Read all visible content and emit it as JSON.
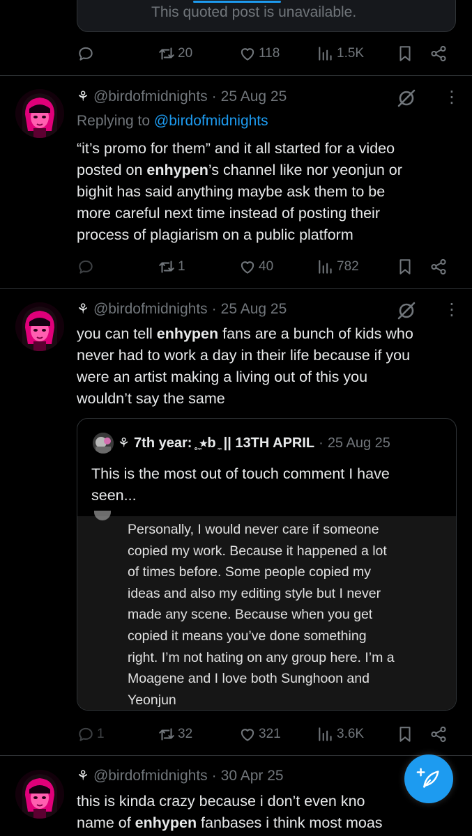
{
  "top_quote": {
    "text": "This quoted post is unavailable."
  },
  "top_actions": {
    "reposts": "20",
    "likes": "118",
    "views": "1.5K"
  },
  "tweets": [
    {
      "handle": "@birdofmidnights",
      "date": "25 Aug 25",
      "replying_label": "Replying to",
      "replying_handle": "@birdofmidnights",
      "lines": [
        [
          "“it’s promo for them” and it all started for a video",
          "",
          ""
        ],
        [
          "posted on ",
          "enhypen",
          "’s channel like nor yeonjun or"
        ],
        [
          "bighit has said anything maybe ask them to be",
          "",
          ""
        ],
        [
          "more careful next time instead of posting their",
          "",
          ""
        ],
        [
          "process of plagiarism on a public platform",
          "",
          ""
        ]
      ],
      "actions": {
        "replies": "",
        "reposts": "1",
        "likes": "40",
        "views": "782"
      }
    },
    {
      "handle": "@birdofmidnights",
      "date": "25 Aug 25",
      "lines": [
        [
          "you can tell ",
          "enhypen",
          " fans are a bunch of kids who"
        ],
        [
          "never had to work a day in their life because if you",
          "",
          ""
        ],
        [
          "were an artist making a living out of this you",
          "",
          ""
        ],
        [
          "wouldn’t say the same",
          "",
          ""
        ]
      ],
      "quote": {
        "name": "7th year: ̥ ̼⭒b ̼ || 13TH APRIL",
        "date": "25 Aug 25",
        "lines": [
          "This is the most out of touch comment I have",
          "seen..."
        ],
        "image_lines": [
          "Personally, I would never care if someone",
          "copied my work. Because it happened a lot",
          "of times before. Some people copied my",
          "ideas and also my editing style but I never",
          "made any scene. Because when you get",
          "copied it means you’ve done something",
          "right. I’m not hating on any group here. I’m a",
          "Moagene and I love both Sunghoon and",
          "Yeonjun"
        ]
      },
      "actions": {
        "replies": "1",
        "reposts": "32",
        "likes": "321",
        "views": "3.6K"
      }
    },
    {
      "handle": "@birdofmidnights",
      "date": "30 Apr 25",
      "lines": [
        [
          "this is kinda crazy because i don’t even kno",
          "",
          ""
        ],
        [
          "name of ",
          "enhypen",
          " fanbases i think most moas"
        ]
      ]
    }
  ],
  "colors": {
    "accent": "#1d9bf0",
    "muted": "#71767b",
    "text": "#e7e9ea",
    "divider": "#2f3336"
  },
  "icons": [
    "reply-icon",
    "repost-icon",
    "like-icon",
    "views-icon",
    "bookmark-icon",
    "share-icon",
    "grok-icon",
    "more-icon",
    "compose-icon"
  ]
}
